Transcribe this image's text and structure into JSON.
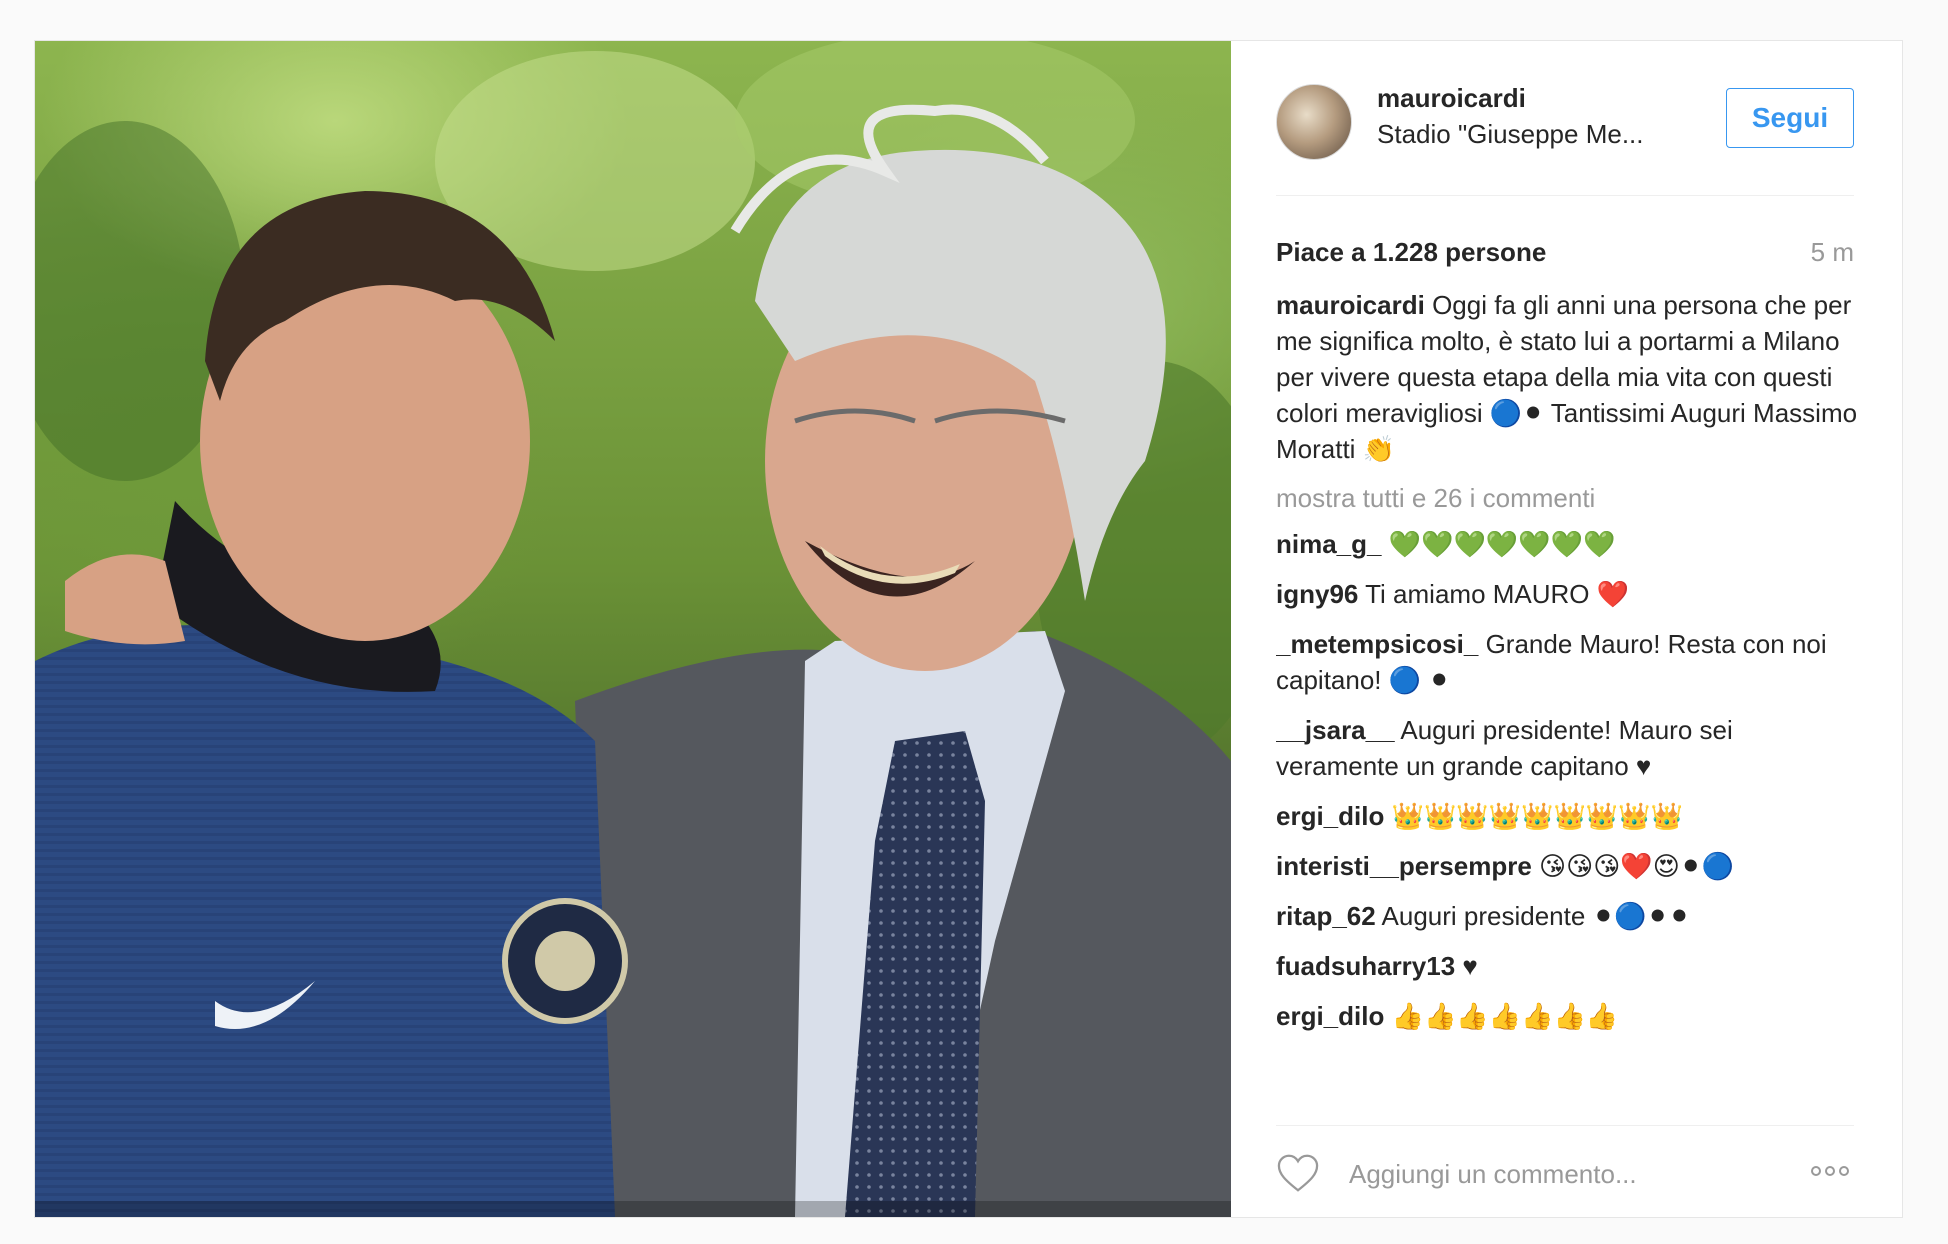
{
  "header": {
    "username": "mauroicardi",
    "location": "Stadio \"Giuseppe Me...",
    "follow_label": "Segui"
  },
  "stats": {
    "likes": "Piace a 1.228 persone",
    "time": "5 m"
  },
  "caption": {
    "username": "mauroicardi",
    "text": "Oggi fa gli anni una persona che per me significa molto, è stato lui a portarmi a Milano per vivere questa etapa della mia vita con questi colori meravigliosi 🔵⚫ Tantissimi Auguri Massimo Moratti 👏"
  },
  "show_all": "mostra tutti e 26 i commenti",
  "comments": [
    {
      "username": "nima_g_",
      "text": "💚💚💚💚💚💚💚"
    },
    {
      "username": "igny96",
      "text": "Ti amiamo MAURO ❤️"
    },
    {
      "username": "_metempsicosi_",
      "text": "Grande Mauro! Resta con noi capitano! 🔵 ⚫"
    },
    {
      "username": "__jsara__",
      "text": "Auguri presidente! Mauro sei veramente un grande capitano ♥"
    },
    {
      "username": "ergi_dilo",
      "text": "👑👑👑👑👑👑👑👑👑"
    },
    {
      "username": "interisti__persempre",
      "text": "😘😘😘❤️😍⚫🔵"
    },
    {
      "username": "ritap_62",
      "text": "Auguri presidente ⚫🔵⚫⚫"
    },
    {
      "username": "fuadsuharry13",
      "text": "♥"
    },
    {
      "username": "ergi_dilo",
      "text": "👍👍👍👍👍👍👍"
    }
  ],
  "composer": {
    "placeholder": "Aggiungi un commento...",
    "heart_icon": "heart-outline-icon",
    "more_icon": "more-options-icon"
  },
  "colors": {
    "accent": "#3897f0",
    "text": "#262626",
    "muted": "#999999",
    "border": "#efefef"
  }
}
